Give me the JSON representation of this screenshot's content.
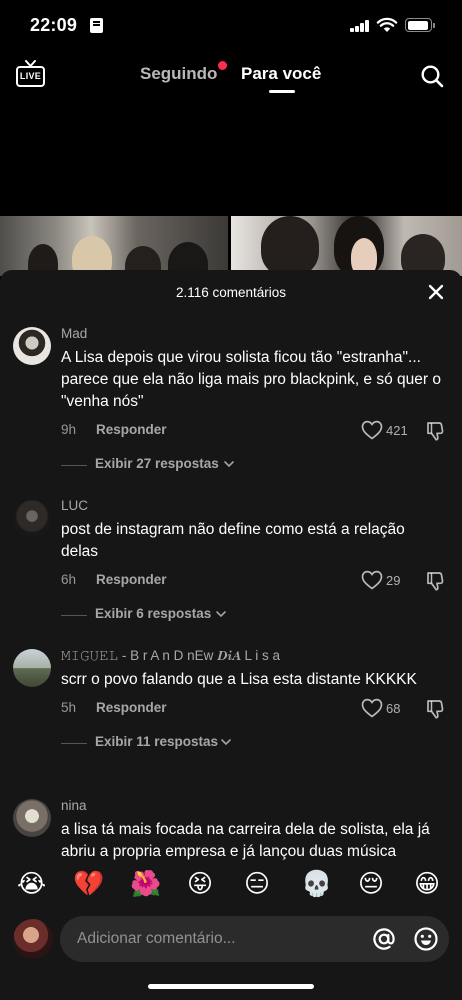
{
  "status_bar": {
    "time": "22:09"
  },
  "top_nav": {
    "live_label": "LIVE",
    "tabs": [
      {
        "label": "Seguindo",
        "active": false,
        "notification_dot": true
      },
      {
        "label": "Para você",
        "active": true
      }
    ]
  },
  "comments_sheet": {
    "title": "2.116 comentários",
    "reply_label": "Responder",
    "comments": [
      {
        "username": "Mad",
        "text": "A Lisa depois que virou solista ficou tão \"estranha\"... parece que ela não liga mais pro blackpink, e só quer o \"venha nós\"",
        "age": "9h",
        "likes": "421",
        "replies_label": "Exibir 27 respostas"
      },
      {
        "username": "LUC",
        "text": "post de instagram não define como está a relação delas",
        "age": "6h",
        "likes": "29",
        "replies_label": "Exibir 6 respostas"
      },
      {
        "username": "𝙼𝙸𝙶𝚄𝙴𝙻 - B r A n D nEw 𝑫𝒊𝑨 L i s a",
        "text": "scrr o povo falando que a Lisa esta distante KKKKK",
        "age": "5h",
        "likes": "68",
        "replies_label": "Exibir 11 respostas"
      },
      {
        "username": "nina",
        "text": "a lisa tá mais focada na carreira dela de solista, ela já abriu a propria empresa e já lançou duas música"
      }
    ]
  },
  "emoji_bar": [
    "😭",
    "💔",
    "🌺",
    "😝",
    "😑",
    "💀",
    "😔",
    "😁"
  ],
  "composer": {
    "placeholder": "Adicionar comentário..."
  },
  "colors": {
    "accent_dot": "#fe2c55",
    "sheet_bg": "#161616",
    "input_bg": "#2b2b2b"
  }
}
